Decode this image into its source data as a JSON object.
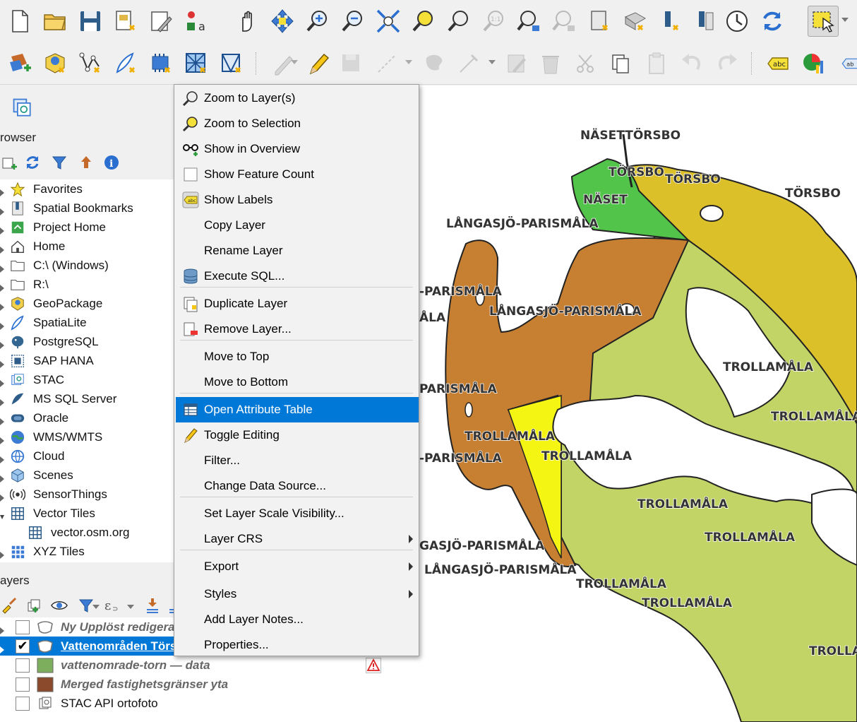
{
  "toolbar_row1": [
    "new-project-icon",
    "open-project-icon",
    "save-project-icon",
    "new-print-layout-icon",
    "style-manager-icon",
    "attribute-tool-icon",
    "pan-icon",
    "pan-to-selection-icon",
    "zoom-in-icon",
    "zoom-out-icon",
    "zoom-full-icon",
    "zoom-to-selection-icon",
    "zoom-to-layer-icon",
    "zoom-native-icon",
    "zoom-last-icon",
    "zoom-next-icon",
    "new-bookmark-icon",
    "show-bookmarks-icon",
    "new-map-view-icon",
    "new-3d-map-icon",
    "temporal-controller-icon",
    "refresh-icon",
    "select-features-icon"
  ],
  "toolbar_row2": [
    "data-source-manager-icon",
    "new-geopackage-layer-icon",
    "new-shapefile-layer-icon",
    "new-spatialite-layer-icon",
    "new-temp-layer-icon",
    "new-virtual-layer-icon",
    "new-mesh-layer-icon",
    "current-edits-icon",
    "toggle-editing-icon",
    "save-edits-icon",
    "digitize-icon",
    "add-polygon-icon",
    "vertex-tool-icon",
    "modify-attributes-icon",
    "delete-selected-icon",
    "cut-features-icon",
    "copy-features-icon",
    "paste-features-icon",
    "undo-icon",
    "redo-icon",
    "label-toolbar-icon",
    "layer-diagram-icon"
  ],
  "browser": {
    "title": "rowser",
    "items": [
      {
        "label": "Favorites",
        "icon": "star-icon"
      },
      {
        "label": "Spatial Bookmarks",
        "icon": "bookmark-icon"
      },
      {
        "label": "Project Home",
        "icon": "project-home-icon"
      },
      {
        "label": "Home",
        "icon": "home-icon"
      },
      {
        "label": "C:\\ (Windows)",
        "icon": "folder-icon"
      },
      {
        "label": "R:\\",
        "icon": "folder-icon"
      },
      {
        "label": "GeoPackage",
        "icon": "geopackage-icon"
      },
      {
        "label": "SpatiaLite",
        "icon": "spatialite-icon"
      },
      {
        "label": "PostgreSQL",
        "icon": "postgresql-icon"
      },
      {
        "label": "SAP HANA",
        "icon": "sap-hana-icon"
      },
      {
        "label": "STAC",
        "icon": "stac-icon"
      },
      {
        "label": "MS SQL Server",
        "icon": "mssql-icon"
      },
      {
        "label": "Oracle",
        "icon": "oracle-icon"
      },
      {
        "label": "WMS/WMTS",
        "icon": "wms-icon"
      },
      {
        "label": "Cloud",
        "icon": "cloud-icon"
      },
      {
        "label": "Scenes",
        "icon": "scenes-icon"
      },
      {
        "label": "SensorThings",
        "icon": "sensorthings-icon"
      },
      {
        "label": "Vector Tiles",
        "icon": "vector-tiles-icon"
      },
      {
        "label": "vector.osm.org",
        "icon": "vector-tiles-icon"
      },
      {
        "label": "XYZ Tiles",
        "icon": "xyz-tiles-icon"
      }
    ]
  },
  "layers": {
    "title": "ayers",
    "items": [
      {
        "label": "Ny Upplöst redigera",
        "checked": false,
        "style": "italic",
        "symbol": "polygon-outline"
      },
      {
        "label": "Vattenområden Törs",
        "checked": true,
        "style": "selected",
        "symbol": "polygon-outline"
      },
      {
        "label": "vattenomrade-torn — data",
        "checked": false,
        "style": "italic",
        "symbol": "#7cae5e"
      },
      {
        "label": "Merged fastighetsgränser yta",
        "checked": false,
        "style": "italic",
        "symbol": "#8b4a2b"
      },
      {
        "label": "STAC API ortofoto",
        "checked": false,
        "style": "normal",
        "symbol": "raster"
      }
    ]
  },
  "context_menu": {
    "items": [
      {
        "label": "Zoom to Layer(s)",
        "icon": "zoom-to-layer-icon"
      },
      {
        "label": "Zoom to Selection",
        "icon": "zoom-to-selection-icon"
      },
      {
        "label": "Show in Overview",
        "icon": "overview-icon"
      },
      {
        "label": "Show Feature Count",
        "icon": "checkbox-icon"
      },
      {
        "label": "Show Labels",
        "icon": "labels-icon"
      },
      {
        "label": "Copy Layer",
        "icon": ""
      },
      {
        "label": "Rename Layer",
        "icon": ""
      },
      {
        "label": "Execute SQL...",
        "icon": "database-icon"
      },
      {
        "label": "Duplicate Layer",
        "icon": "duplicate-layer-icon"
      },
      {
        "label": "Remove Layer...",
        "icon": "remove-layer-icon"
      },
      {
        "label": "Move to Top",
        "icon": ""
      },
      {
        "label": "Move to Bottom",
        "icon": ""
      },
      {
        "label": "Open Attribute Table",
        "icon": "attribute-table-icon"
      },
      {
        "label": "Toggle Editing",
        "icon": "pencil-icon"
      },
      {
        "label": "Filter...",
        "icon": ""
      },
      {
        "label": "Change Data Source...",
        "icon": ""
      },
      {
        "label": "Set Layer Scale Visibility...",
        "icon": ""
      },
      {
        "label": "Layer CRS",
        "icon": ""
      },
      {
        "label": "Export",
        "icon": ""
      },
      {
        "label": "Styles",
        "icon": ""
      },
      {
        "label": "Add Layer Notes...",
        "icon": ""
      },
      {
        "label": "Properties...",
        "icon": ""
      }
    ]
  },
  "map": {
    "labels": [
      "NÄSETTÖRSBO",
      "TÖRSBO",
      "TÖRSBO",
      "TÖRSBO",
      "NÄSET",
      "LÅNGASJÖ-PARISMÅLA",
      "-PARISMÅLA",
      "ÅLA",
      "LÅNGASJÖ-PARISMÅLA",
      "TROLLAMÅLA",
      "PARISMÅLA",
      "TROLLAMÅLA",
      "TROLLAMÅLA",
      "TROLLAMÅLA",
      "-PARISMÅLA",
      "TROLLAMÅLA",
      "TROLLAMÅLA",
      "GASJÖ-PARISMÅLA",
      "LÅNGASJÖ-PARISMÅLA",
      "TROLLAMÅLA",
      "TROLLAMÅLA",
      "TROLLA"
    ],
    "colors": {
      "brown": "#c77f32",
      "light_green": "#c2d466",
      "green": "#52c44a",
      "mustard": "#dcc02a",
      "yellow": "#f5f513"
    }
  }
}
